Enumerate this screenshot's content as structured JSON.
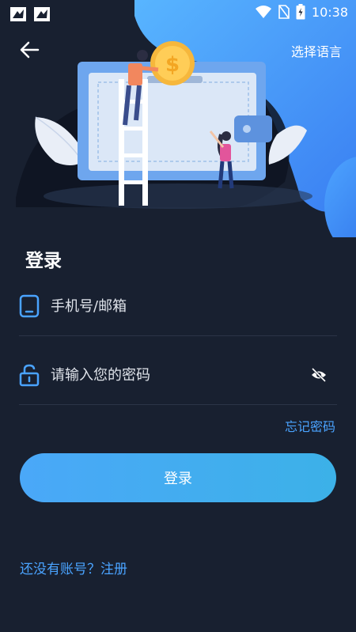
{
  "status_bar": {
    "time": "10:38"
  },
  "header": {
    "language_label": "选择语言"
  },
  "login": {
    "title": "登录",
    "phone_placeholder": "手机号/邮箱",
    "password_placeholder": "请输入您的密码",
    "forgot_label": "忘记密码",
    "submit_label": "登录",
    "register_label": "还没有账号？注册"
  },
  "colors": {
    "background": "#182030",
    "accent": "#4aa3ff",
    "button_gradient_start": "#4aa8f8",
    "button_gradient_end": "#3cb1e8"
  },
  "icons": [
    "back-arrow-icon",
    "phone-icon",
    "lock-icon",
    "eye-off-icon",
    "wifi-icon",
    "battery-icon"
  ]
}
